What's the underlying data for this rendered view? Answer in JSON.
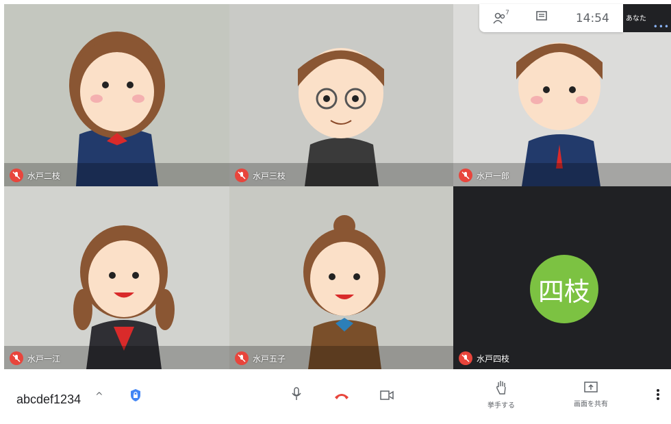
{
  "participants": [
    {
      "name": "水戸二枝",
      "muted": true
    },
    {
      "name": "水戸三枝",
      "muted": true
    },
    {
      "name": "水戸一郎",
      "muted": true
    },
    {
      "name": "水戸一江",
      "muted": true
    },
    {
      "name": "水戸五子",
      "muted": true
    },
    {
      "name": "水戸四枝",
      "muted": true,
      "avatar_text": "四枝"
    }
  ],
  "topbar": {
    "people_count": "7",
    "time": "14:54",
    "you_label": "あなた"
  },
  "bottombar": {
    "meeting_code": "abcdef1234",
    "raise_hand_label": "挙手する",
    "share_screen_label": "画面を共有"
  },
  "colors": {
    "accent_red": "#e8453c",
    "avatar_green": "#7cc242",
    "dark_tile": "#202124",
    "shield_blue": "#4285f4"
  }
}
